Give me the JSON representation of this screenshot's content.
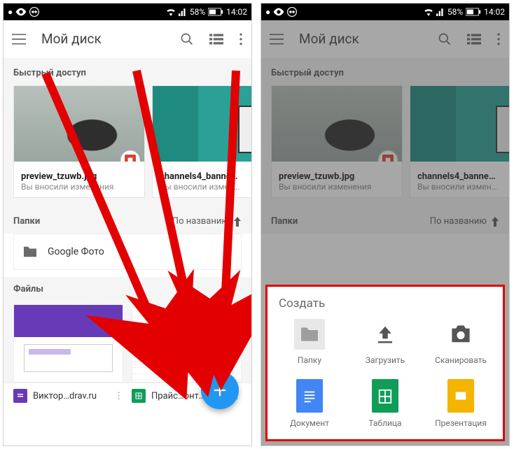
{
  "status": {
    "battery_pct": "58%",
    "time": "14:02"
  },
  "appbar": {
    "title": "Мой диск"
  },
  "sections": {
    "quick_access": "Быстрый доступ",
    "folders": "Папки",
    "files": "Файлы",
    "sort_label": "По названию"
  },
  "quick_items": [
    {
      "name": "preview_tzuwb.jpg",
      "sub": "Вы вносили изменения"
    },
    {
      "name": "channels4_banne…",
      "sub": "Вы вносили измен…"
    }
  ],
  "folders": [
    {
      "name": "Google Фото"
    }
  ],
  "bottom_files": [
    {
      "name": "Виктор…drav.ru",
      "type": "forms"
    },
    {
      "name": "Прайс…онт…",
      "type": "sheets"
    }
  ],
  "sheet": {
    "title": "Создать",
    "items": [
      {
        "label": "Папку",
        "icon": "folder"
      },
      {
        "label": "Загрузить",
        "icon": "upload"
      },
      {
        "label": "Сканировать",
        "icon": "camera"
      },
      {
        "label": "Документ",
        "icon": "doc"
      },
      {
        "label": "Таблица",
        "icon": "sheet"
      },
      {
        "label": "Презентация",
        "icon": "slide"
      }
    ]
  },
  "colors": {
    "fab": "#2196f3",
    "arrow": "#e30000"
  }
}
